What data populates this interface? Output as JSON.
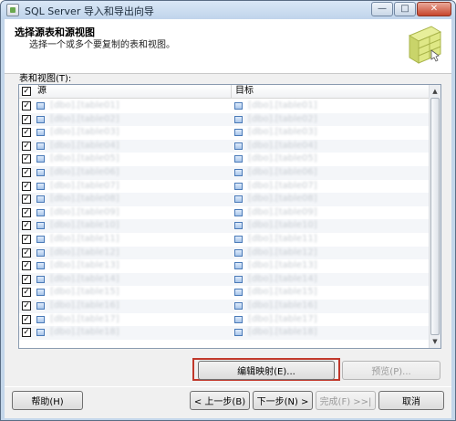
{
  "window": {
    "title": "SQL Server 导入和导出向导",
    "minimize": "—",
    "maximize": "□",
    "close": "✕"
  },
  "header": {
    "title": "选择源表和源视图",
    "subtitle": "选择一个或多个要复制的表和视图。"
  },
  "list": {
    "label": "表和视图(T):",
    "columns": {
      "source": "源",
      "target": "目标"
    },
    "rows": [
      {
        "source": "[dbo].[table01]",
        "target": "[dbo].[table01]"
      },
      {
        "source": "[dbo].[table02]",
        "target": "[dbo].[table02]"
      },
      {
        "source": "[dbo].[table03]",
        "target": "[dbo].[table03]"
      },
      {
        "source": "[dbo].[table04]",
        "target": "[dbo].[table04]"
      },
      {
        "source": "[dbo].[table05]",
        "target": "[dbo].[table05]"
      },
      {
        "source": "[dbo].[table06]",
        "target": "[dbo].[table06]"
      },
      {
        "source": "[dbo].[table07]",
        "target": "[dbo].[table07]"
      },
      {
        "source": "[dbo].[table08]",
        "target": "[dbo].[table08]"
      },
      {
        "source": "[dbo].[table09]",
        "target": "[dbo].[table09]"
      },
      {
        "source": "[dbo].[table10]",
        "target": "[dbo].[table10]"
      },
      {
        "source": "[dbo].[table11]",
        "target": "[dbo].[table11]"
      },
      {
        "source": "[dbo].[table12]",
        "target": "[dbo].[table12]"
      },
      {
        "source": "[dbo].[table13]",
        "target": "[dbo].[table13]"
      },
      {
        "source": "[dbo].[table14]",
        "target": "[dbo].[table14]"
      },
      {
        "source": "[dbo].[table15]",
        "target": "[dbo].[table15]"
      },
      {
        "source": "[dbo].[table16]",
        "target": "[dbo].[table16]"
      },
      {
        "source": "[dbo].[table17]",
        "target": "[dbo].[table17]"
      },
      {
        "source": "[dbo].[table18]",
        "target": "[dbo].[table18]"
      }
    ]
  },
  "buttons": {
    "edit_mappings": "编辑映射(E)...",
    "preview": "预览(P)...",
    "help": "帮助(H)",
    "back": "< 上一步(B)",
    "next": "下一步(N) >",
    "finish": "完成(F) >>|",
    "cancel": "取消"
  }
}
